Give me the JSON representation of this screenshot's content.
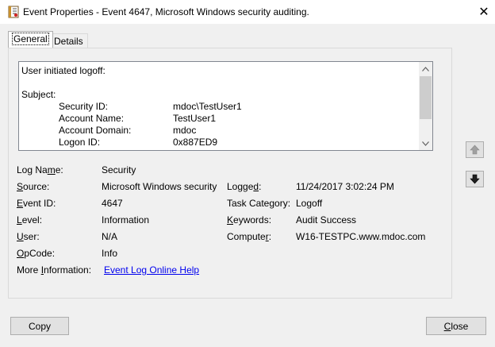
{
  "window": {
    "title": "Event Properties - Event 4647, Microsoft Windows security auditing.",
    "close_glyph": "✕"
  },
  "tabs": [
    {
      "label": "General",
      "active": true
    },
    {
      "label": "Details",
      "active": false
    }
  ],
  "message": {
    "line1": "User initiated logoff:",
    "subject_label": "Subject:",
    "rows": [
      {
        "key": "Security ID:",
        "value": "mdoc\\TestUser1"
      },
      {
        "key": "Account Name:",
        "value": "TestUser1"
      },
      {
        "key": "Account Domain:",
        "value": "mdoc"
      },
      {
        "key": "Logon ID:",
        "value": "0x887ED9"
      }
    ]
  },
  "fields": {
    "log_name": {
      "label": "Log Name:",
      "value": "Security"
    },
    "source": {
      "label": "Source:",
      "value": "Microsoft Windows security"
    },
    "logged": {
      "label": "Logged:",
      "value": "11/24/2017 3:02:24 PM"
    },
    "event_id": {
      "label": "Event ID:",
      "value": "4647"
    },
    "task_category": {
      "label": "Task Category:",
      "value": "Logoff"
    },
    "level": {
      "label": "Level:",
      "value": "Information"
    },
    "keywords": {
      "label": "Keywords:",
      "value": "Audit Success"
    },
    "user": {
      "label": "User:",
      "value": "N/A"
    },
    "computer": {
      "label": "Computer:",
      "value": "W16-TESTPC.www.mdoc.com"
    },
    "opcode": {
      "label": "OpCode:",
      "value": "Info"
    },
    "more_info": {
      "label": "More Information:",
      "link": "Event Log Online Help"
    }
  },
  "buttons": {
    "copy": "Copy",
    "close": "Close"
  },
  "colors": {
    "link": "#0000ee",
    "nav_up_arrow": "#a0a0a0",
    "nav_down_arrow": "#202020"
  }
}
